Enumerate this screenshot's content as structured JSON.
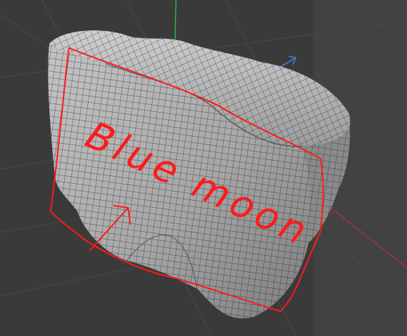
{
  "viewport": {
    "background": "#3a3a3a",
    "grid_color": "#4a4a4a",
    "axis_colors": {
      "x": "#c8333a",
      "y": "#2fb84a",
      "z": "#3f7fd8"
    }
  },
  "mesh": {
    "fill": "#a9a9a9",
    "wire_color": "#1a1a1a",
    "display": "wireframe-on-shaded"
  },
  "annotation": {
    "text": "Blue moon",
    "color": "#ff1a1a",
    "marks": [
      "outline",
      "arrow"
    ]
  }
}
